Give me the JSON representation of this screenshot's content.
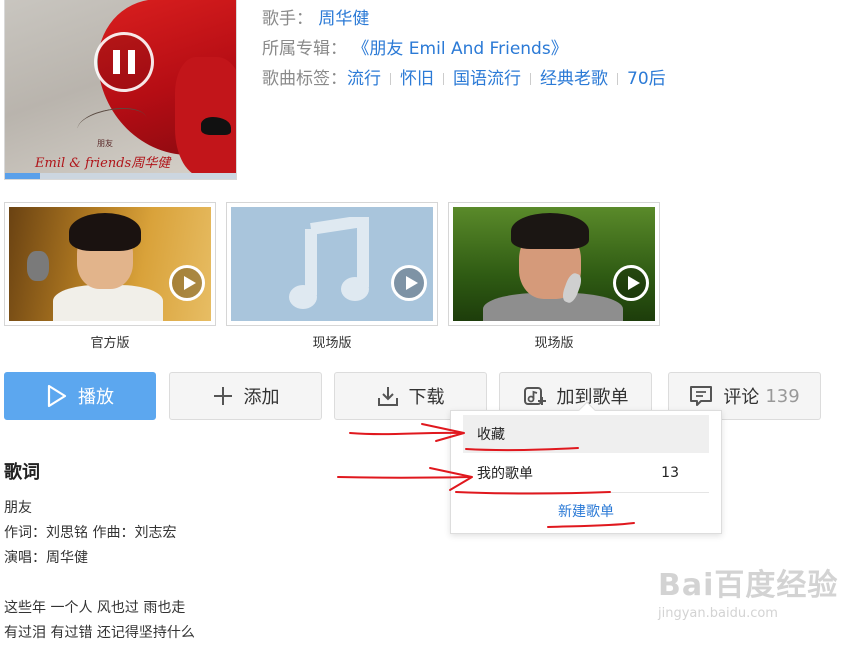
{
  "song_info": {
    "singer_key": "歌手：",
    "singer": "周华健",
    "album_key": "所属专辑：",
    "album": "《朋友 Emil And Friends》",
    "tags_key": "歌曲标签：",
    "tags": [
      "流行",
      "怀旧",
      "国语流行",
      "经典老歌",
      "70后"
    ]
  },
  "player": {
    "cover_caption": "Emil & friends周华健",
    "cover_small_text": "朋友",
    "state": "playing",
    "progress": 0.15
  },
  "videos": [
    {
      "label": "官方版"
    },
    {
      "label": "现场版"
    },
    {
      "label": "现场版"
    }
  ],
  "actions": {
    "play": "播放",
    "add": "添加",
    "download": "下载",
    "add_to_playlist": "加到歌单",
    "comment": "评论",
    "comment_count": "139"
  },
  "playlist_dropdown": {
    "favorites": "收藏",
    "my_playlists": "我的歌单",
    "my_playlists_count": "13",
    "create": "新建歌单"
  },
  "lyrics": {
    "title": "歌词",
    "lines": [
      "朋友",
      "作词：刘思铭 作曲：刘志宏",
      "演唱：周华健",
      "",
      "这些年 一个人 风也过 雨也走",
      "有过泪 有过错 还记得坚持什么"
    ]
  },
  "watermark": {
    "logo": "Bai百度经验",
    "url": "jingyan.baidu.com"
  },
  "colors": {
    "link": "#2b7ad6",
    "primary_button": "#5ca7ef",
    "annotation": "#e0181e"
  }
}
